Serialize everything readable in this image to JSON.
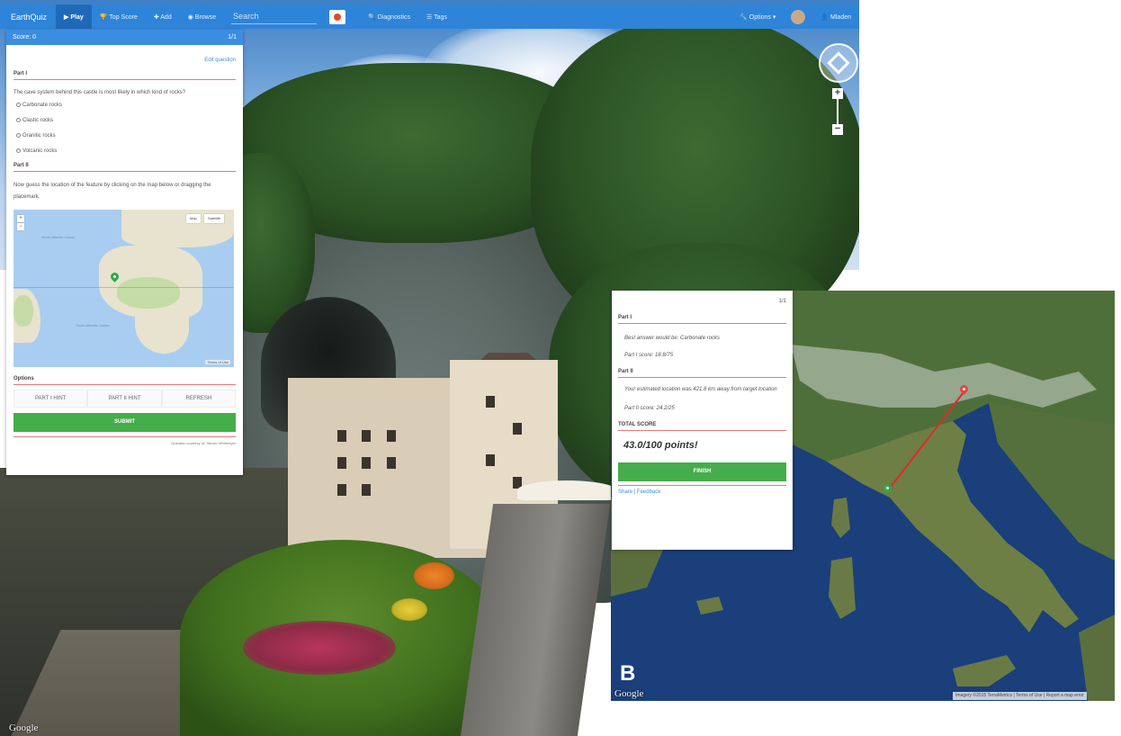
{
  "navbar": {
    "brand": "EarthQuiz",
    "items": [
      {
        "label": "▶ Play",
        "active": true
      },
      {
        "label": "🏆 Top Score"
      },
      {
        "label": "✚ Add"
      },
      {
        "label": "◉ Browse"
      }
    ],
    "search_placeholder": "Search",
    "right_items": [
      {
        "label": "🔍 Diagnostics"
      },
      {
        "label": "☰ Tags"
      }
    ],
    "options_label": "🔧 Options ▾",
    "user_label": "👤 Mladen"
  },
  "quiz": {
    "score_label": "Score: 0",
    "counter": "1/1",
    "edit_link": "Edit question",
    "part1_title": "Part I",
    "question": "The cave system behind this castle is most likely in which kind of rocks?",
    "options": [
      "Carbonate rocks",
      "Clastic rocks",
      "Granitic rocks",
      "Volcanic rocks"
    ],
    "part2_title": "Part II",
    "instruction": "Now guess the location of the feature by clicking on the map below or dragging the placemark.",
    "map": {
      "toggle_map": "Map",
      "toggle_satellite": "Satellite",
      "ocean_north": "North Atlantic Ocean",
      "ocean_south": "South Atlantic Ocean",
      "terms": "Terms of Use"
    },
    "options_title": "Options",
    "hints": [
      "PART I HINT",
      "PART II HINT",
      "REFRESH"
    ],
    "submit_label": "SUBMIT",
    "credit": "Question courtesy of: Steven Whitmeyer"
  },
  "result": {
    "counter": "1/1",
    "part1_title": "Part I",
    "best_answer": "Best answer would be: Carbonate rocks",
    "part1_score": "Part I score: 18.8/75",
    "part2_title": "Part II",
    "distance_text": "Your estimated location was 421.8 km away from target location",
    "part2_score": "Part II score: 24.2/25",
    "total_title": "TOTAL SCORE",
    "total_score": "43.0/100 points!",
    "finish_label": "FINISH",
    "share_link": "Share",
    "separator": "|",
    "feedback_link": "Feedback"
  },
  "panel_b_label": "B",
  "google_label": "Google",
  "attribution_b": "Imagery ©2015 TerraMetrics | Terms of Use | Report a map error",
  "colors": {
    "navbar": "#2e84d9",
    "accent_green": "#45ad4a",
    "accent_red": "#e07a7a",
    "link_blue": "#3b8de0",
    "pin_red": "#e5463a",
    "pin_green": "#2fa84a",
    "line_red": "#e02a2a"
  },
  "icons": [
    "play-icon",
    "trophy-icon",
    "add-icon",
    "browse-icon",
    "search-icon",
    "tags-icon",
    "wrench-icon",
    "user-icon",
    "compass-icon",
    "zoom-in-icon",
    "zoom-out-icon",
    "placemark-icon"
  ]
}
